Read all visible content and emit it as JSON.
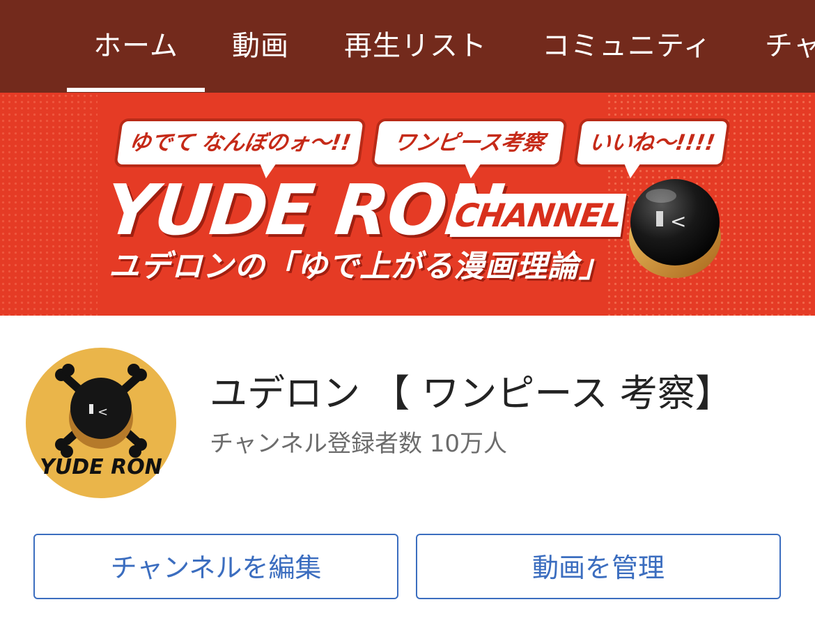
{
  "tabs": [
    {
      "label": "ホーム",
      "selected": true
    },
    {
      "label": "動画",
      "selected": false
    },
    {
      "label": "再生リスト",
      "selected": false
    },
    {
      "label": "コミュニティ",
      "selected": false
    },
    {
      "label": "チャ",
      "selected": false
    }
  ],
  "banner": {
    "bubbles": [
      "ゆでて なんぼのォ〜!!",
      "ワンピース考察",
      "いいね〜!!!!"
    ],
    "logo": "YUDE RON",
    "logo_suffix": "CHANNEL",
    "subtitle": "ユデロンの「ゆで上がる漫画理論」",
    "colors": {
      "background": "#e53b25",
      "accent": "#c52a18"
    }
  },
  "channel": {
    "name": "ユデロン 【 ワンピース 考察】",
    "subscribers": "チャンネル登録者数 10万人",
    "avatar_text": "YUDE RON",
    "avatar_color": "#eab54a"
  },
  "actions": {
    "edit_label": "チャンネルを編集",
    "manage_label": "動画を管理",
    "accent_color": "#3b6dbf"
  },
  "colors": {
    "tabbar": "#732a1c",
    "banner": "#e53b25",
    "text_primary": "#232323",
    "text_secondary": "#6c6c6c"
  }
}
